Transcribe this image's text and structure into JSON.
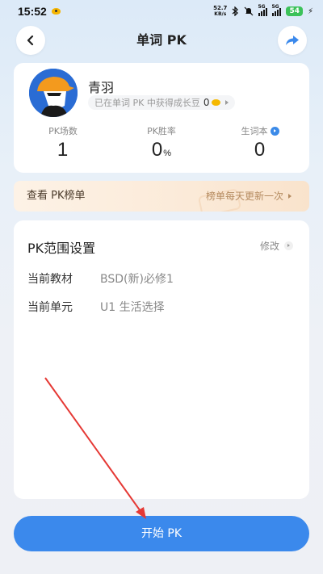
{
  "status_bar": {
    "time": "15:52",
    "net_speed_value": "52.7",
    "net_speed_unit": "KB/s",
    "sim1": "5G",
    "sim2": "5G",
    "battery": "54"
  },
  "header": {
    "title": "单词 PK",
    "back_icon": "chevron-left-icon",
    "share_icon": "share-arrow-icon"
  },
  "profile": {
    "name": "青羽",
    "bean_text": "已在单词 PK 中获得成长豆",
    "bean_count": "0",
    "stats": [
      {
        "label": "PK场数",
        "value": "1",
        "unit": ""
      },
      {
        "label": "PK胜率",
        "value": "0",
        "unit": "%"
      },
      {
        "label": "生词本",
        "value": "0",
        "unit": ""
      }
    ]
  },
  "rank_banner": {
    "left": "查看 PK榜单",
    "right": "榜单每天更新一次"
  },
  "scope": {
    "title": "PK范围设置",
    "modify": "修改",
    "textbook_label": "当前教材",
    "textbook_value": "BSD(新)必修1",
    "unit_label": "当前单元",
    "unit_value": "U1 生活选择"
  },
  "start_button": "开始 PK",
  "colors": {
    "accent": "#3b89ec",
    "annotation": "#e53935"
  }
}
